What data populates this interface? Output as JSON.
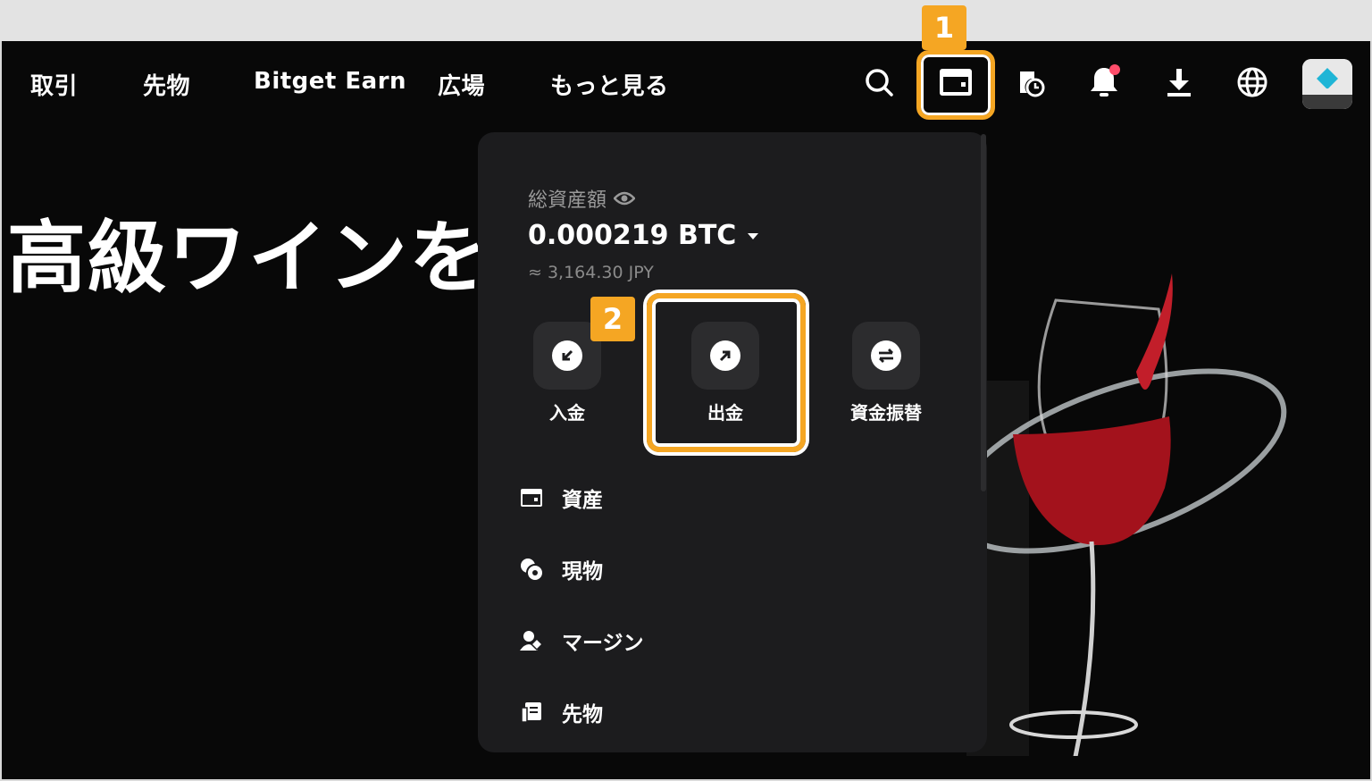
{
  "nav": {
    "items": [
      "取引",
      "先物",
      "Bitget Earn",
      "広場",
      "もっと見る"
    ],
    "icons": [
      "search-icon",
      "wallet-icon",
      "order-history-icon",
      "bell-icon",
      "download-icon",
      "globe-icon"
    ]
  },
  "hero": {
    "title": "高級ワインを"
  },
  "wallet": {
    "total_label": "総資産額",
    "balance": "0.000219 BTC",
    "fiat": "≈ 3,164.30 JPY",
    "actions": [
      {
        "label": "入金",
        "icon": "deposit-arrow-icon"
      },
      {
        "label": "出金",
        "icon": "withdraw-arrow-icon"
      },
      {
        "label": "資金振替",
        "icon": "transfer-icon"
      }
    ],
    "menu": [
      {
        "label": "資産",
        "icon": "wallet-icon"
      },
      {
        "label": "現物",
        "icon": "coins-icon"
      },
      {
        "label": "マージン",
        "icon": "margin-icon"
      },
      {
        "label": "先物",
        "icon": "futures-icon"
      }
    ]
  },
  "annotations": {
    "step1": "1",
    "step2": "2",
    "color": "#f5a623"
  }
}
